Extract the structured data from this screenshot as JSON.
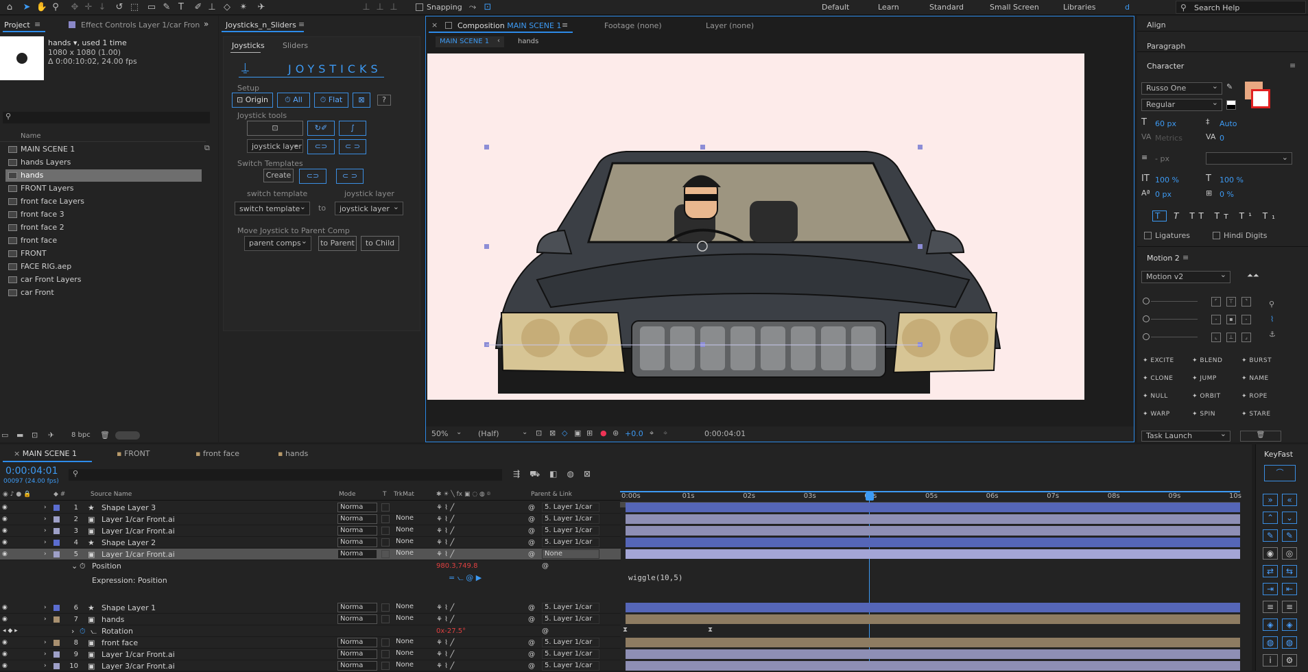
{
  "topbar": {
    "snapping": "Snapping",
    "workspaces": [
      "Default",
      "Learn",
      "Standard",
      "Small Screen",
      "Libraries"
    ],
    "overflow": "d",
    "search_placeholder": "Search Help"
  },
  "project": {
    "tab": "Project",
    "effect_tab": "Effect Controls Layer 1/car Fron",
    "item_name": "hands",
    "item_used": ", used 1 time",
    "item_size": "1080 x 1080 (1.00)",
    "item_duration": "Δ 0:00:10:02, 24.00 fps",
    "search_placeholder": "",
    "col_name": "Name",
    "items": [
      "MAIN SCENE 1",
      "hands Layers",
      "hands",
      "FRONT Layers",
      "front face Layers",
      "front face 3",
      "front face 2",
      "front face",
      "FRONT",
      "FACE RIG.aep",
      "car Front Layers",
      "car Front"
    ],
    "bpc": "8 bpc"
  },
  "joysticks": {
    "panel_title": "Joysticks_n_Sliders",
    "tab_joysticks": "Joysticks",
    "tab_sliders": "Sliders",
    "banner": "JOYSTICKS",
    "setup": "Setup",
    "origin": "Origin",
    "all": "All",
    "flat": "Flat",
    "help": "?",
    "tools": "Joystick tools",
    "joystick_layer": "joystick layer",
    "switch_templates": "Switch Templates",
    "create": "Create",
    "switch_template_lbl": "switch template",
    "joystick_layer_lbl": "joystick layer",
    "switch_template_sel": "switch template",
    "to": "to",
    "joystick_layer_sel": "joystick layer",
    "move_title": "Move Joystick to Parent Comp",
    "parent_comps": "parent comps",
    "to_parent": "to Parent",
    "to_child": "to Child"
  },
  "composition": {
    "tab": "Composition",
    "tab_name": "MAIN SCENE 1",
    "footage": "Footage (none)",
    "layer": "Layer (none)",
    "crumb1": "MAIN SCENE 1",
    "crumb2": "hands",
    "zoom": "50%",
    "resolution": "(Half)",
    "exposure": "+0.0",
    "timecode": "0:00:04:01",
    "bg_color": "#fdebea"
  },
  "right": {
    "align": "Align",
    "paragraph": "Paragraph",
    "character": "Character",
    "font": "Russo One",
    "style": "Regular",
    "size": "60 px",
    "leading": "Auto",
    "kerning": "Metrics",
    "tracking": "0",
    "stroke": "- px",
    "vscale": "100 %",
    "hscale": "100 %",
    "baseline": "0 px",
    "tsume": "0 %",
    "ligatures": "Ligatures",
    "hindi": "Hindi Digits",
    "fill_color": "#e8a882",
    "motion_title": "Motion 2",
    "motion_version": "Motion v2",
    "buttons": [
      "EXCITE",
      "BLEND",
      "BURST",
      "CLONE",
      "JUMP",
      "NAME",
      "NULL",
      "ORBIT",
      "ROPE",
      "WARP",
      "SPIN",
      "STARE"
    ],
    "task": "Task Launch"
  },
  "timeline": {
    "tabs": [
      "MAIN SCENE 1",
      "FRONT",
      "front face",
      "hands"
    ],
    "timecode": "0:00:04:01",
    "frames": "00097 (24.00 fps)",
    "col_source": "Source Name",
    "col_mode": "Mode",
    "col_t": "T",
    "col_trkmat": "TrkMat",
    "col_parent": "Parent & Link",
    "ruler": [
      "0:00s",
      "01s",
      "02s",
      "03s",
      "04s",
      "05s",
      "06s",
      "07s",
      "08s",
      "09s",
      "10s"
    ],
    "layers": [
      {
        "num": "1",
        "name": "Shape Layer 3",
        "mode": "Norma",
        "trk": "",
        "parent": "5. Layer 1/car",
        "color": "#5b6dd0",
        "bar": "#5566b8",
        "star": true
      },
      {
        "num": "2",
        "name": "Layer 1/car Front.ai",
        "mode": "Norma",
        "trk": "None",
        "parent": "5. Layer 1/car",
        "color": "#9ea0c8",
        "bar": "#8e8fb5",
        "star": false
      },
      {
        "num": "3",
        "name": "Layer 1/car Front.ai",
        "mode": "Norma",
        "trk": "None",
        "parent": "5. Layer 1/car",
        "color": "#9ea0c8",
        "bar": "#8e8fb5",
        "star": false
      },
      {
        "num": "4",
        "name": "Shape Layer 2",
        "mode": "Norma",
        "trk": "None",
        "parent": "5. Layer 1/car",
        "color": "#5b6dd0",
        "bar": "#5566b8",
        "star": true
      },
      {
        "num": "5",
        "name": "Layer 1/car Front.ai",
        "mode": "Norma",
        "trk": "None",
        "parent": "None",
        "color": "#9ea0c8",
        "bar": "#a4a5d6",
        "star": false
      }
    ],
    "position_label": "Position",
    "position_value": "980.3,749.8",
    "expression_label": "Expression: Position",
    "expression_text": "wiggle(10,5)",
    "layers2": [
      {
        "num": "6",
        "name": "Shape Layer 1",
        "mode": "Norma",
        "trk": "None",
        "parent": "5. Layer 1/car",
        "color": "#5b6dd0",
        "bar": "#5566b8",
        "star": true
      },
      {
        "num": "7",
        "name": "hands",
        "mode": "Norma",
        "trk": "None",
        "parent": "5. Layer 1/car",
        "color": "#a89070",
        "bar": "#8e7c62",
        "star": false
      }
    ],
    "rotation_label": "Rotation",
    "rotation_value": "0x-27.5°",
    "layers3": [
      {
        "num": "8",
        "name": "front face",
        "mode": "Norma",
        "trk": "None",
        "parent": "5. Layer 1/car",
        "color": "#a89070",
        "bar": "#8e7c62",
        "star": false
      },
      {
        "num": "9",
        "name": "Layer 1/car Front.ai",
        "mode": "Norma",
        "trk": "None",
        "parent": "5. Layer 1/car",
        "color": "#9ea0c8",
        "bar": "#8e8fb5",
        "star": false
      },
      {
        "num": "10",
        "name": "Layer 3/car Front.ai",
        "mode": "Norma",
        "trk": "None",
        "parent": "5. Layer 1/car",
        "color": "#9ea0c8",
        "bar": "#8e8fb5",
        "star": false
      }
    ]
  },
  "keyfast": {
    "title": "KeyFast"
  }
}
